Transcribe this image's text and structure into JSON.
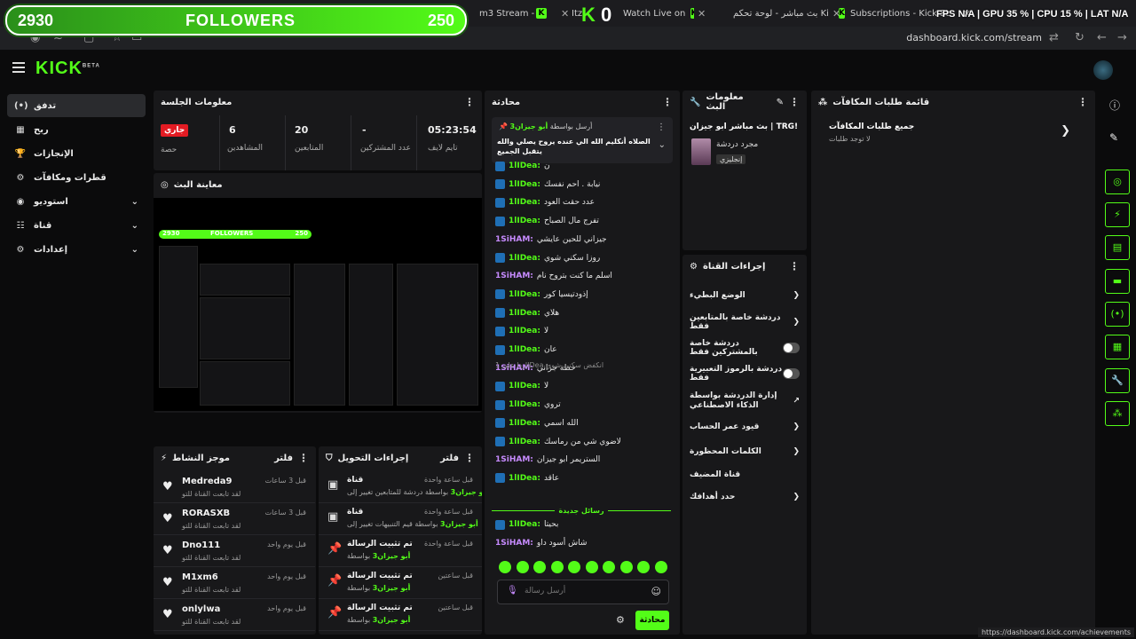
{
  "browser": {
    "tabs": [
      {
        "label": "m3 Stream - Watch"
      },
      {
        "label": "Itz"
      },
      {
        "label": "Watch Live on"
      },
      {
        "label": "بث مباشر - لوحة تحكم Kick"
      },
      {
        "label": "Subscriptions - Kick Streaming"
      }
    ],
    "url": "dashboard.kick.com/stream",
    "status_url": "https://dashboard.kick.com/achievements"
  },
  "overlay": {
    "followers_current": "2930",
    "followers_label": "FOLLOWERS",
    "followers_goal": "250",
    "center_count": "0",
    "hud_text": "FPS N/A | GPU 35 % | CPU 15 % | LAT N/A"
  },
  "app": {
    "logo": "KICK",
    "logo_badge": "BETA"
  },
  "nav": {
    "items": [
      {
        "label": "تدفق",
        "icon": "(•)"
      },
      {
        "label": "ربح",
        "icon": "▦"
      },
      {
        "label": "الإنجازات",
        "icon": "🏆"
      },
      {
        "label": "قطرات ومكافآت",
        "icon": "⚙"
      },
      {
        "label": "استوديو",
        "icon": "◉"
      },
      {
        "label": "قناة",
        "icon": "☷"
      },
      {
        "label": "إعدادات",
        "icon": "⚙"
      }
    ]
  },
  "session": {
    "title": "معلومات الجلسة",
    "live_badge": "جاري",
    "live_label": "حصة",
    "stats": [
      {
        "value": "6",
        "label": "المشاهدين"
      },
      {
        "value": "20",
        "label": "المتابعين"
      },
      {
        "value": "-",
        "label": "عدد المشتركين"
      },
      {
        "value": "05:23:54",
        "label": "تايم لايف"
      }
    ]
  },
  "preview": {
    "title": "معاينة البث",
    "mini_followers": "FOLLOWERS",
    "mini_current": "2930",
    "mini_goal": "250"
  },
  "activity": {
    "title": "موجز النشاط",
    "filter_label": "فلتر",
    "rows": [
      {
        "name": "Medreda9",
        "sub": "لقد تابعت القناة للتو",
        "time": "قبل 3 ساعات"
      },
      {
        "name": "RORASXB",
        "sub": "لقد تابعت القناة للتو",
        "time": "قبل 3 ساعات"
      },
      {
        "name": "Dno111",
        "sub": "لقد تابعت القناة للتو",
        "time": "قبل يوم واحد"
      },
      {
        "name": "M1xm6",
        "sub": "لقد تابعت القناة للتو",
        "time": "قبل يوم واحد"
      },
      {
        "name": "onlylwa",
        "sub": "لقد تابعت القناة للتو",
        "time": "قبل يوم واحد"
      }
    ]
  },
  "mod_actions": {
    "title": "إجراءات التحويل",
    "filter_label": "فلتر",
    "rows": [
      {
        "title": "قناة",
        "user": "أبو جيزان3",
        "desc": "بواسطة دردشة للمتابعين تغيير إلى",
        "time": "قبل ساعة واحدة"
      },
      {
        "title": "قناة",
        "user": "أبو جيزان3",
        "desc": "بواسطة قيم التنبيهات تغيير إلى",
        "time": "قبل ساعة واحدة"
      },
      {
        "title": "تم تثبيت الرسالة",
        "user": "أبو جيزان3",
        "desc": "بواسطة",
        "time": "قبل ساعة واحدة"
      },
      {
        "title": "تم تثبيت الرسالة",
        "user": "أبو جيزان3",
        "desc": "بواسطة",
        "time": "قبل ساعتين"
      },
      {
        "title": "تم تثبيت الرسالة",
        "user": "أبو جيزان3",
        "desc": "بواسطة",
        "time": "قبل ساعتين"
      }
    ]
  },
  "chat": {
    "title": "محادثة",
    "pinned_by": "أرسل بواسطة",
    "pinned_user": "أبو جيزان3",
    "pinned_text": "الصلاه أنكليم الله الي عنده يروح يصلي والله يتقبل الجميع",
    "top_partial": "ن",
    "messages": [
      {
        "user": "1lIDea",
        "msg": "ن",
        "alt": false
      },
      {
        "user": "1lIDea",
        "msg": "نيابة . احم نفسك",
        "alt": false
      },
      {
        "user": "1lIDea",
        "msg": "عدد حقت العود",
        "alt": false
      },
      {
        "user": "1lIDea",
        "msg": "تفرج مال الصباح",
        "alt": false
      },
      {
        "user": "1SiHAM",
        "msg": "جيزاني للحين عايشي",
        "alt": true
      },
      {
        "user": "1lIDea",
        "msg": "روزا سكني شوي",
        "alt": false
      },
      {
        "user": "1SiHAM",
        "msg": "اسلم ما كنت بتروح نام",
        "alt": true
      },
      {
        "user": "1lIDea",
        "msg": "إذودتيسيا كور",
        "alt": false
      },
      {
        "user": "1lIDea",
        "msg": "هلاي",
        "alt": false
      },
      {
        "user": "1lIDea",
        "msg": "لا",
        "alt": false
      },
      {
        "user": "1lIDea",
        "msg": "عان",
        "alt": false
      },
      {
        "user": "1SiHAM",
        "msg": "حطة جزاني",
        "alt": true
      },
      {
        "user": "1lIDea",
        "msg": "لا",
        "alt": false
      },
      {
        "user": "1lIDea",
        "msg": "تروي",
        "alt": false
      },
      {
        "user": "1lIDea",
        "msg": "الله اسمي",
        "alt": false
      },
      {
        "user": "1lIDea",
        "msg": "لاضوي شي من رماسك",
        "alt": false
      },
      {
        "user": "1SiHAM",
        "msg": "الستريمر ابو جيزان",
        "alt": true
      },
      {
        "user": "1lIDea",
        "msg": "عاقد",
        "alt": false
      }
    ],
    "reply_hint": "ردا على 1lIDea انكفض سكني شوي",
    "new_messages": "رسائل جديدة",
    "after": [
      {
        "user": "1lIDea",
        "msg": "بحيتا",
        "alt": false
      },
      {
        "user": "1SiHAM",
        "msg": "شاش أسود داو",
        "alt": true
      }
    ],
    "input_placeholder": "أرسل رسالة",
    "send_label": "محادثة"
  },
  "stream_info": {
    "title": "معلومات البث",
    "stream_title": "بث مباشر أبو جيزان | TRG! TM!",
    "category": "مجرد دردشة",
    "tag": "إنجليزي"
  },
  "channel_actions": {
    "title": "إجراءات القناة",
    "rows": [
      {
        "label": "الوضع البطيء",
        "kind": "chevron"
      },
      {
        "label": "دردشة خاصة بالمتابعين فقط",
        "kind": "chevron"
      },
      {
        "label": "دردشة خاصة بالمشتركين فقط",
        "kind": "toggle"
      },
      {
        "label": "دردشة بالرموز التعبيرية فقط",
        "kind": "toggle"
      },
      {
        "label": "إدارة الدردشة بواسطة الذكاء الاصطناعي",
        "kind": "link"
      },
      {
        "label": "قيود عمر الحساب",
        "kind": "chevron"
      },
      {
        "label": "الكلمات المحظورة",
        "kind": "chevron"
      },
      {
        "label": "قناة المضيف",
        "kind": "none"
      },
      {
        "label": "حدد أهدافك",
        "kind": "chevron"
      }
    ]
  },
  "rewards": {
    "title": "قائمة طلبات المكافآت",
    "all_label": "جميع طلبات المكافآت",
    "empty": "لا توجد طلبات"
  },
  "colors": {
    "accent": "#53fc18",
    "live": "#e31b23",
    "panel": "#18181a"
  }
}
